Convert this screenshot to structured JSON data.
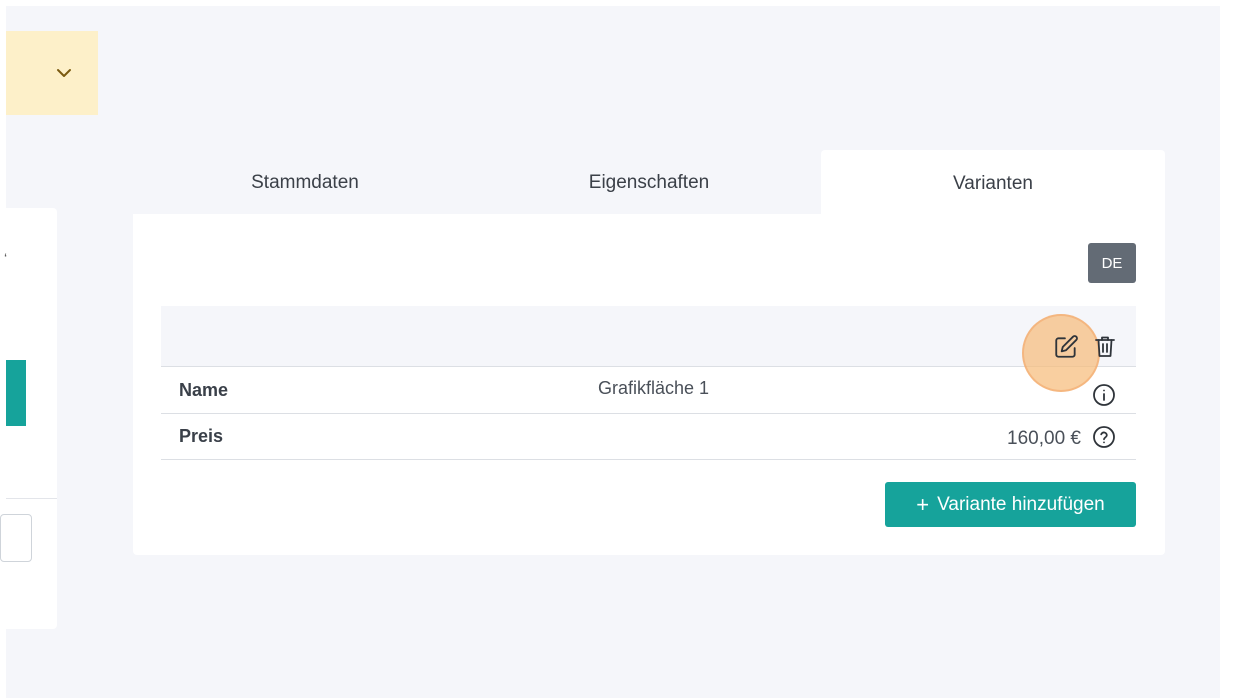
{
  "tabs": [
    {
      "label": "Stammdaten",
      "active": false
    },
    {
      "label": "Eigenschaften",
      "active": false
    },
    {
      "label": "Varianten",
      "active": true
    }
  ],
  "language_badge": "DE",
  "variant": {
    "rows": [
      {
        "label": "Name",
        "value": "Grafikfläche 1",
        "icon": "info-icon"
      },
      {
        "label": "Preis",
        "value": "160,00 €",
        "icon": "help-icon"
      }
    ],
    "actions": [
      "edit-icon",
      "trash-icon"
    ]
  },
  "add_button": {
    "icon": "plus",
    "label": "Variante hinzufügen"
  },
  "colors": {
    "accent": "#16a39b",
    "badge": "#636b75",
    "highlight": "#f7ba78",
    "dropdown_bg": "#fdf0c9",
    "page_bg": "#f5f6fa"
  }
}
